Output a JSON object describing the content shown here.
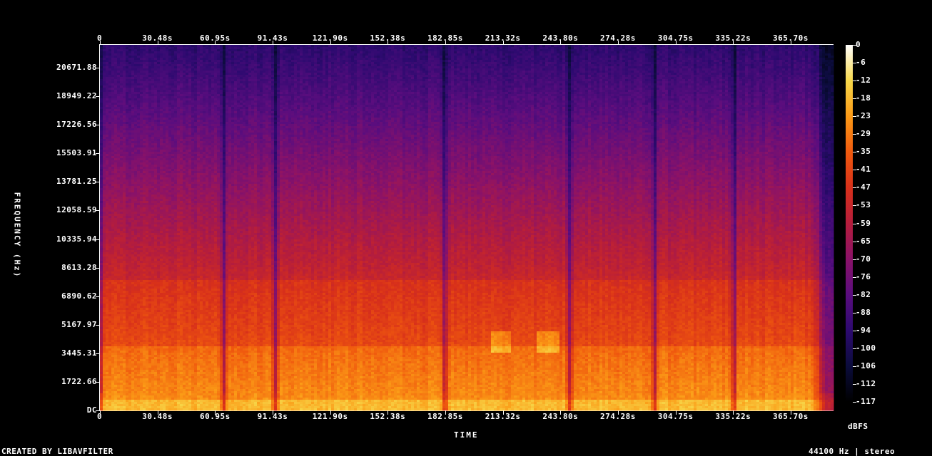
{
  "chart_data": {
    "type": "heatmap",
    "xlabel": "TIME",
    "ylabel": "FREQUENCY (Hz)",
    "colorbar_label": "dBFS",
    "x_ticks": [
      "0",
      "30.48s",
      "60.95s",
      "91.43s",
      "121.90s",
      "152.38s",
      "182.85s",
      "213.32s",
      "243.80s",
      "274.28s",
      "304.75s",
      "335.22s",
      "365.70s"
    ],
    "x_tick_values": [
      0,
      30.48,
      60.95,
      91.43,
      121.9,
      152.38,
      182.85,
      213.32,
      243.8,
      274.28,
      304.75,
      335.22,
      365.7
    ],
    "y_ticks": [
      "DC",
      "1722.66",
      "3445.31",
      "5167.97",
      "6890.62",
      "8613.28",
      "10335.94",
      "12058.59",
      "13781.25",
      "15503.91",
      "17226.56",
      "18949.22",
      "20671.88"
    ],
    "y_tick_values": [
      0,
      1722.66,
      3445.31,
      5167.97,
      6890.62,
      8613.28,
      10335.94,
      12058.59,
      13781.25,
      15503.91,
      17226.56,
      18949.22,
      20671.88
    ],
    "colorbar_ticks": [
      "0",
      "-6",
      "-12",
      "-18",
      "-23",
      "-29",
      "-35",
      "-41",
      "-47",
      "-53",
      "-59",
      "-65",
      "-70",
      "-76",
      "-82",
      "-88",
      "-94",
      "-100",
      "-106",
      "-112",
      "-117"
    ],
    "colorbar_range": [
      -117,
      0
    ],
    "xlim": [
      0,
      388
    ],
    "ylim": [
      0,
      22050
    ],
    "colormap": [
      "#000000",
      "#0b0c3c",
      "#2d0a70",
      "#5a0d7e",
      "#8a1268",
      "#b51d3c",
      "#d8301a",
      "#f05a0e",
      "#fb9a16",
      "#f7d84a",
      "#ffffff"
    ],
    "quiet_gaps_s": [
      65,
      92,
      182,
      248,
      293,
      335
    ],
    "strong_band_s": [
      [
        206,
        217
      ],
      [
        230,
        243
      ]
    ],
    "grid": false
  },
  "footer": {
    "left": "CREATED BY LIBAVFILTER",
    "right": "44100 Hz | stereo"
  }
}
